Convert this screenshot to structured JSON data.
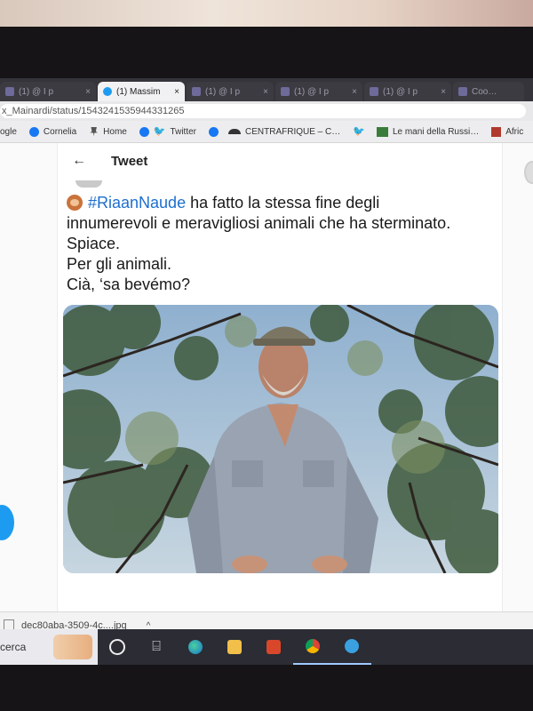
{
  "tabs": [
    {
      "label": "(1) @ I p",
      "active": false
    },
    {
      "label": "(1) Massim",
      "active": true
    },
    {
      "label": "(1) @ I p",
      "active": false
    },
    {
      "label": "(1) @ I p",
      "active": false
    },
    {
      "label": "(1) @ I p",
      "active": false
    },
    {
      "label": "Coo…",
      "active": false
    }
  ],
  "address_bar": {
    "url": "x_Mainardi/status/1543241535944331265"
  },
  "bookmarks": [
    {
      "label": "ogle",
      "icon": "google-icon"
    },
    {
      "label": "Cornelia",
      "icon": "facebook-icon"
    },
    {
      "label": "Home",
      "icon": "pin-icon"
    },
    {
      "label": "Twitter",
      "icon": "twitter-icon"
    },
    {
      "label": "CENTRAFRIQUE – C…",
      "icon": "hat-icon"
    },
    {
      "label": "Le mani della Russi…",
      "icon": "site-icon"
    },
    {
      "label": "Afric",
      "icon": "site-icon"
    }
  ],
  "tweet": {
    "header_title": "Tweet",
    "hashtag": "#RiaanNaude",
    "line1_rest": " ha fatto la stessa fine degli",
    "line2": "innumerevoli e meravigliosi animali che ha sterminato.",
    "line3": "Spiace.",
    "line4": "Per gli animali.",
    "line5": "Cià, ‘sa bevémo?",
    "emoji": "monkey-face-icon"
  },
  "left_rail": {
    "more_label": "..."
  },
  "download": {
    "filename": "dec80aba-3509-4c....jpg",
    "chevron": "^"
  },
  "taskbar": {
    "search_text": "cerca"
  },
  "colors": {
    "twitter_blue": "#1d9bf0",
    "hashtag": "#1d6fd0",
    "taskbar": "#2b2c34"
  }
}
